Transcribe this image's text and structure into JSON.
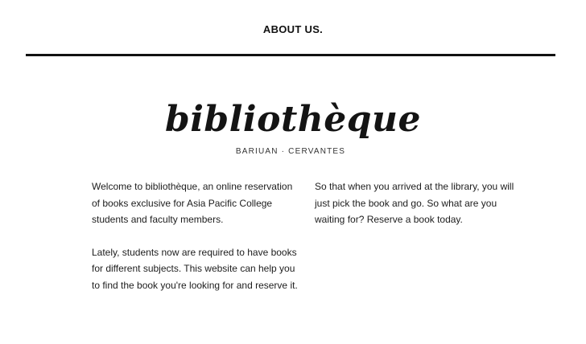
{
  "nav": {
    "about_label": "ABOUT US."
  },
  "brand": {
    "logo_text": "bibliothèque",
    "subtitle": "BARIUAN · CERVANTES"
  },
  "content": {
    "left_paragraphs": [
      "Welcome to bibliothèque, an online reservation of books exclusive for Asia Pacific College students and faculty members.",
      "Lately, students now are required to have books for different subjects. This website can help you to find the book you're looking for and reserve it."
    ],
    "right_paragraphs": [
      "So that when you arrived at the library, you will just pick the book and go. So what are you waiting for? Reserve a book today."
    ]
  },
  "colors": {
    "text": "#1a1a1a",
    "divider": "#111111",
    "background": "#ffffff"
  }
}
